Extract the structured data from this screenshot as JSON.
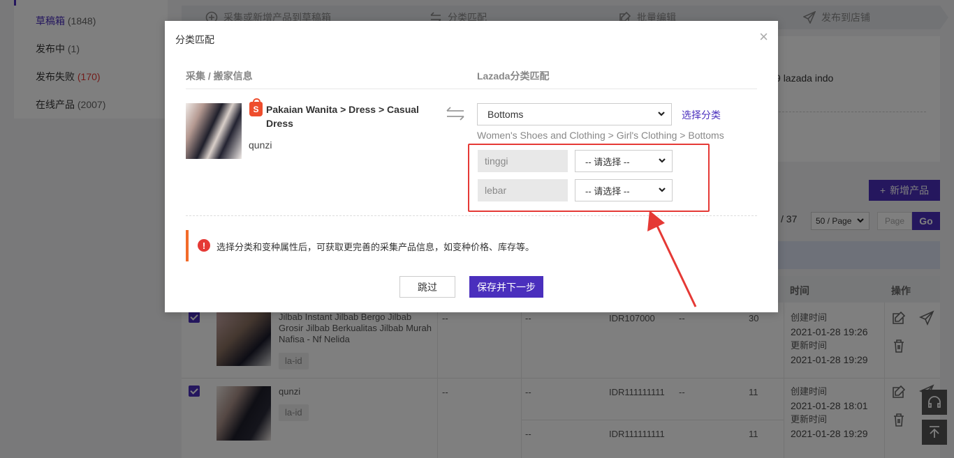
{
  "sidebar": {
    "items": [
      {
        "label": "草稿箱",
        "count": "(1848)"
      },
      {
        "label": "发布中",
        "count": "(1)"
      },
      {
        "label": "发布失败",
        "count": "(170)"
      },
      {
        "label": "在线产品",
        "count": "(2007)"
      }
    ]
  },
  "steps": [
    {
      "label": "采集或新增产品到草稿箱"
    },
    {
      "label": "分类匹配"
    },
    {
      "label": "批量编辑"
    },
    {
      "label": "发布到店铺"
    }
  ],
  "shop": {
    "name": "lazada indo",
    "prefix": "9"
  },
  "toolbar": {
    "add_product": "新增产品"
  },
  "pager": {
    "total": "/ 37",
    "page_size": "50 / Page",
    "page_placeholder": "Page",
    "go": "Go"
  },
  "table": {
    "headers": {
      "time": "时间",
      "actions": "操作"
    },
    "rows": [
      {
        "title": "Jilbab Instant Jilbab Bergo Jilbab Grosir Jilbab Berkualitas Jilbab Murah Nafisa - Nf Nelida",
        "tag": "la-id",
        "c1": "--",
        "c2": "--",
        "price": "IDR107000",
        "c3": "--",
        "stock": "30",
        "created_label": "创建时间",
        "created": "2021-01-28 19:26",
        "updated_label": "更新时间",
        "updated": "2021-01-28 19:29"
      },
      {
        "title": "qunzi",
        "tag": "la-id",
        "c1": "--",
        "c2": "--",
        "price": "IDR111111111",
        "c3": "--",
        "stock": "11",
        "c2b": "--",
        "price_b": "IDR111111111",
        "c3b": "--",
        "stock_b": "11",
        "created_label": "创建时间",
        "created": "2021-01-28 18:01",
        "updated_label": "更新时间",
        "updated": "2021-01-28 19:29"
      }
    ]
  },
  "modal": {
    "title": "分类匹配",
    "close": "×",
    "left_header": "采集 / 搬家信息",
    "right_header": "Lazada分类匹配",
    "source_category": "Pakaian Wanita > Dress > Casual Dress",
    "source_shop_icon": "S",
    "source_name": "qunzi",
    "selected_category": "Bottoms",
    "choose_category": "选择分类",
    "category_path": "Women's Shoes and Clothing > Girl's Clothing > Bottoms",
    "attributes": [
      {
        "name": "tinggi",
        "value": "-- 请选择 --"
      },
      {
        "name": "lebar",
        "value": "-- 请选择 --"
      }
    ],
    "tip_icon": "!",
    "tip": "选择分类和变种属性后，可获取更完善的采集产品信息，如变种价格、库存等。",
    "skip": "跳过",
    "save_next": "保存并下一步"
  },
  "colors": {
    "accent": "#4a2fbd",
    "highlight": "#e53935",
    "warning": "#f26b2a",
    "shopee": "#ee4d2d"
  }
}
